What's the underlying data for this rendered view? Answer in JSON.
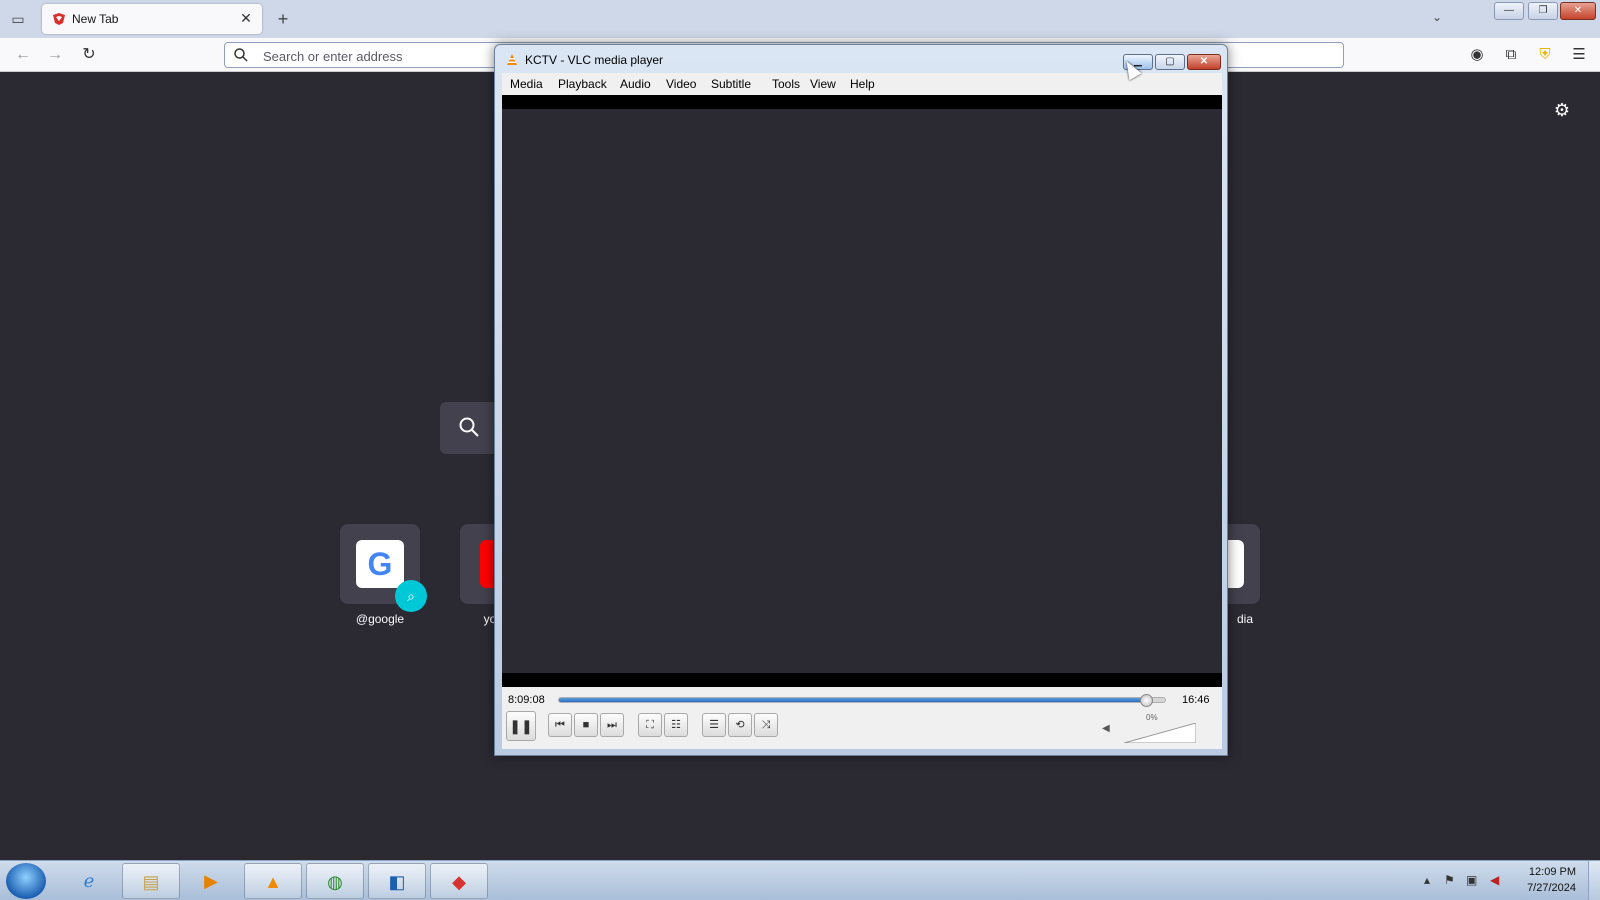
{
  "browser": {
    "tab": {
      "title": "New Tab",
      "close_icon": "close-icon"
    },
    "new_tab_label": "+",
    "urlbar": {
      "placeholder": "Search or enter address"
    },
    "page": {
      "shortcuts": [
        {
          "label": "@google",
          "icon": "google-icon"
        },
        {
          "label": "yo",
          "icon": "youtube-icon"
        },
        {
          "label": "dia",
          "icon": "wikipedia-icon"
        }
      ]
    }
  },
  "vlc": {
    "title": "KCTV - VLC media player",
    "menu": [
      "Media",
      "Playback",
      "Audio",
      "Video",
      "Subtitle",
      "Tools",
      "View",
      "Help"
    ],
    "elapsed": "8:09:08",
    "total": "16:46",
    "progress": 0.965,
    "volume_label": "0%",
    "volume": 0,
    "colors": {
      "seek": "#2c6dbf",
      "close": "#c2412a"
    }
  },
  "taskbar": {
    "apps": [
      "internet-explorer-icon",
      "file-explorer-icon",
      "media-player-icon",
      "vlc-icon",
      "network-app-icon",
      "outlook-icon",
      "browser-icon"
    ],
    "clock": {
      "time": "12:09 PM",
      "date": "7/27/2024"
    }
  }
}
